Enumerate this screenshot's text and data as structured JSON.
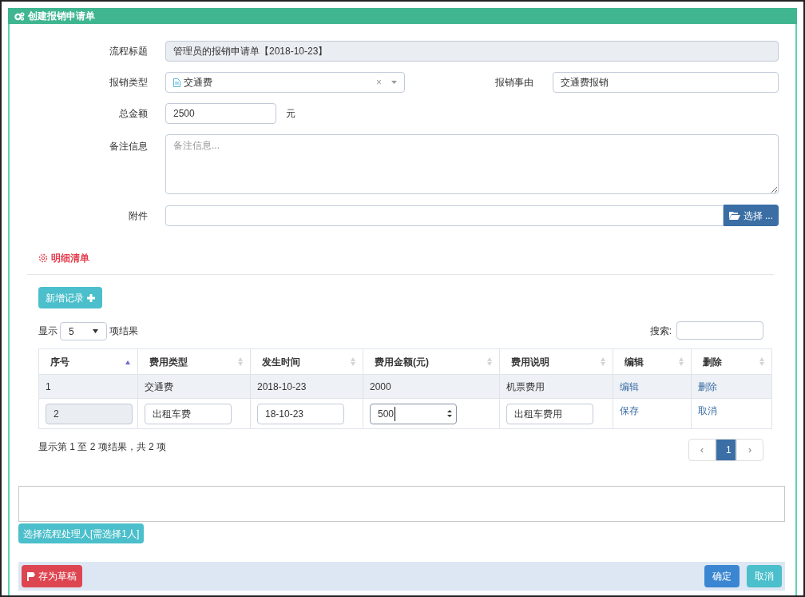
{
  "window": {
    "title": "创建报销申请单"
  },
  "form": {
    "title_field": {
      "label": "流程标题",
      "value": "管理员的报销申请单【2018-10-23】"
    },
    "type_field": {
      "label": "报销类型",
      "value": "交通费",
      "clear": "×"
    },
    "reason_field": {
      "label": "报销事由",
      "value": "交通费报销"
    },
    "amount_field": {
      "label": "总金额",
      "value": "2500",
      "unit": "元"
    },
    "remark_field": {
      "label": "备注信息",
      "placeholder": "备注信息..."
    },
    "attachment_field": {
      "label": "附件",
      "button": "选择 ..."
    }
  },
  "detail": {
    "title": "明细清单",
    "add_button": "新增记录",
    "length": {
      "prefix": "显示",
      "value": "5",
      "suffix": "项结果"
    },
    "search_label": "搜索:",
    "columns": [
      {
        "label": "序号",
        "sorted": true
      },
      {
        "label": "费用类型",
        "sorted": false
      },
      {
        "label": "发生时间",
        "sorted": false
      },
      {
        "label": "费用金额(元)",
        "sorted": false
      },
      {
        "label": "费用说明",
        "sorted": false
      },
      {
        "label": "编辑",
        "sorted": false
      },
      {
        "label": "删除",
        "sorted": false
      }
    ],
    "rows": [
      {
        "cells": [
          {
            "kind": "text",
            "value": "1"
          },
          {
            "kind": "text",
            "value": "交通费"
          },
          {
            "kind": "text",
            "value": "2018-10-23"
          },
          {
            "kind": "text",
            "value": "2000"
          },
          {
            "kind": "text",
            "value": "机票费用"
          },
          {
            "kind": "link",
            "value": "编辑"
          },
          {
            "kind": "link",
            "value": "删除"
          }
        ]
      },
      {
        "cells": [
          {
            "kind": "readonly",
            "value": "2"
          },
          {
            "kind": "input",
            "value": "出租车费"
          },
          {
            "kind": "input",
            "value": "18-10-23"
          },
          {
            "kind": "number",
            "value": "500"
          },
          {
            "kind": "input",
            "value": "出租车费用"
          },
          {
            "kind": "link",
            "value": "保存"
          },
          {
            "kind": "link",
            "value": "取消"
          }
        ]
      }
    ],
    "info": "显示第 1 至 2 项结果，共 2 项",
    "pagination": {
      "prev": "‹",
      "pages": [
        {
          "label": "1",
          "selected": true
        }
      ],
      "next": "›"
    }
  },
  "assign_button": "选择流程处理人[需选择1人]",
  "footer": {
    "draft_button": "存为草稿",
    "ok_button": "确定",
    "cancel_button": "取消"
  }
}
